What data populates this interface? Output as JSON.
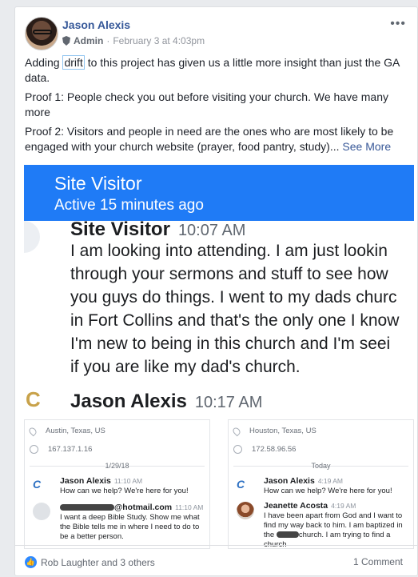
{
  "post": {
    "author": "Jason Alexis",
    "role": "Admin",
    "timestamp": "February 3 at 4:03pm",
    "more_icon": "more-horizontal-icon",
    "text_line1_pre": "Adding ",
    "text_line1_drift": "drift",
    "text_line1_post": " to this project has given us a little more insight than just the GA data.",
    "text_proof1": "Proof 1: People check you out before visiting your church. We have many more",
    "text_proof2": "Proof 2: Visitors and people in need are the ones who are most likely to be engaged with your church website (prayer, food pantry, study)...",
    "see_more": "See More"
  },
  "screenshot": {
    "header_title": "Site Visitor",
    "header_status": "Active 15 minutes ago",
    "visitor_name": "Site Visitor",
    "visitor_time": "10:07 AM",
    "visitor_message": "I am looking into attending. I am just lookin\nthrough your sermons and stuff to see how\nyou guys do things. I went to my dads churc\nin Fort Collins and that's the only one I know\nI'm new to being in this church and I'm seei\nif you are like my dad's church.",
    "reply_name": "Jason Alexis",
    "reply_time": "10:17 AM",
    "logo_glyph": "C",
    "panels": [
      {
        "location": "Austin, Texas, US",
        "ip": "167.137.1.16",
        "date": "1/29/18",
        "admin_name": "Jason Alexis",
        "admin_time": "11:10 AM",
        "admin_msg": "How can we help? We're here for you!",
        "visitor_email": "@hotmail.com",
        "visitor_time": "11:10 AM",
        "visitor_msg": "I want a deep Bible Study. Show me what the Bible tells me in where I need to do to be a better person."
      },
      {
        "location": "Houston, Texas, US",
        "ip": "172.58.96.56",
        "date": "Today",
        "admin_name": "Jason Alexis",
        "admin_time": "4:19 AM",
        "admin_msg": "How can we help? We're here for you!",
        "visitor_name": "Jeanette Acosta",
        "visitor_time": "4:19 AM",
        "visitor_msg_a": "I have been apart from God and I want to find my way back to him. I am baptized in the",
        "visitor_msg_b": "church. I am trying to find a church"
      }
    ]
  },
  "footer": {
    "likes_text": "Rob Laughter and 3 others",
    "like_icon": "thumbs-up-icon",
    "like_glyph": "👍",
    "comments_text": "1 Comment"
  },
  "colors": {
    "accent": "#1f7bf6",
    "link": "#365899",
    "like": "#2e89ff"
  }
}
